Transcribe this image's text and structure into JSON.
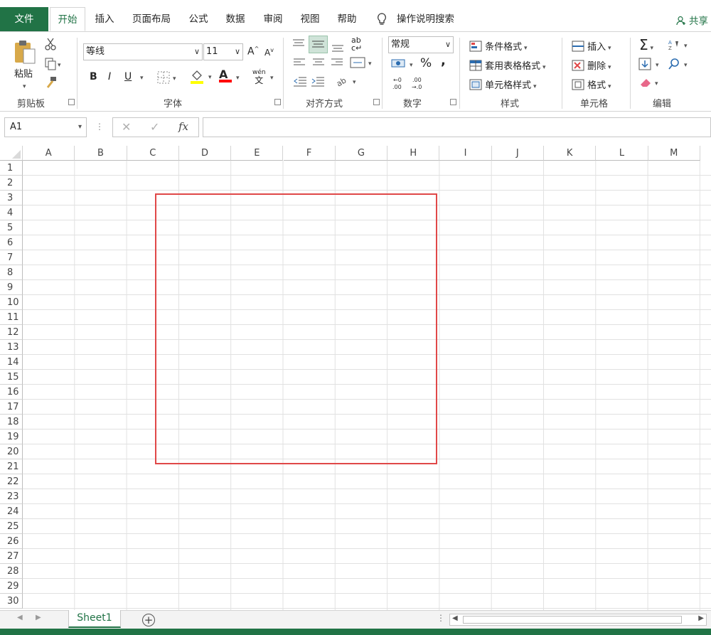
{
  "tabs": {
    "file": "文件",
    "home": "开始",
    "insert": "插入",
    "page_layout": "页面布局",
    "formulas": "公式",
    "data": "数据",
    "review": "审阅",
    "view": "视图",
    "help": "帮助",
    "search": "操作说明搜索",
    "share": "共享"
  },
  "ribbon": {
    "clipboard": {
      "paste": "粘贴",
      "label": "剪贴板"
    },
    "font": {
      "name": "等线",
      "size": "11",
      "grow": "A",
      "shrink": "A",
      "bold": "B",
      "italic": "I",
      "underline": "U",
      "font_color": "A",
      "phonetic": "wén",
      "phonetic_char": "文",
      "label": "字体"
    },
    "alignment": {
      "wrap": "ab",
      "label": "对齐方式"
    },
    "number": {
      "format": "常规",
      "percent": "%",
      "comma": ",",
      "label": "数字"
    },
    "styles": {
      "conditional": "条件格式",
      "table": "套用表格格式",
      "cell_styles": "单元格样式",
      "label": "样式"
    },
    "cells": {
      "insert": "插入",
      "delete": "删除",
      "format": "格式",
      "label": "单元格"
    },
    "editing": {
      "sum": "Σ",
      "label": "编辑"
    }
  },
  "formula_bar": {
    "name_box": "A1",
    "fx": "fx",
    "value": ""
  },
  "columns": [
    "A",
    "B",
    "C",
    "D",
    "E",
    "F",
    "G",
    "H",
    "I",
    "J",
    "K",
    "L",
    "M"
  ],
  "rows": [
    "1",
    "2",
    "3",
    "4",
    "5",
    "6",
    "7",
    "8",
    "9",
    "10",
    "11",
    "12",
    "13",
    "14",
    "15",
    "16",
    "17",
    "18",
    "19",
    "20",
    "21",
    "22",
    "23",
    "24",
    "25",
    "26",
    "27",
    "28",
    "29",
    "30"
  ],
  "sheets": [
    "Sheet1"
  ],
  "add_sheet": "+",
  "colors": {
    "accent": "#217346",
    "highlight_box": "#e04848",
    "fill_yellow": "#ffff00",
    "font_red": "#ff0000"
  }
}
